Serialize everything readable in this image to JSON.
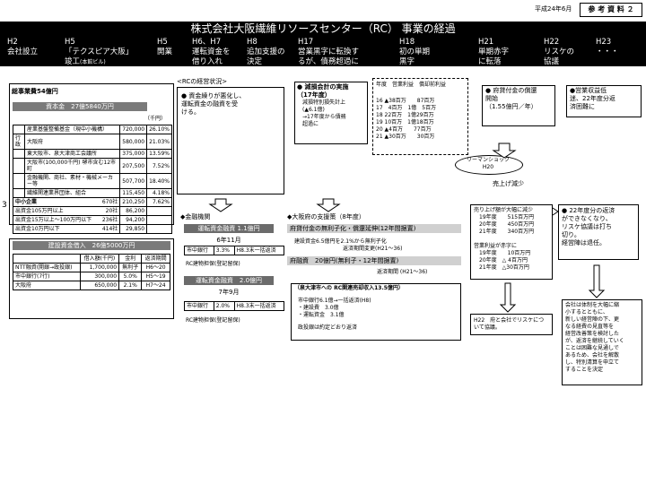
{
  "meta": {
    "date": "平成24年6月",
    "ref": "参 考 資 料 ２"
  },
  "title": "株式会社大阪繊維リソースセンター（RC） 事業の経過",
  "timeline": [
    {
      "era": "H2",
      "text": "会社設立"
    },
    {
      "era": "H5",
      "text": "「テクスピア大阪」",
      "text2": "竣工",
      "sub": "(本館ビル)"
    },
    {
      "era": "H5",
      "text": "開業"
    },
    {
      "era": "H6、H7",
      "text": "運転資金を\n借り入れ"
    },
    {
      "era": "H8",
      "text": "追加支援の\n決定"
    },
    {
      "era": "H17",
      "text": "営業黒字に転換す\nるが、債務超過に"
    },
    {
      "era": "H18",
      "text": "初の単期\n黒字"
    },
    {
      "era": "H21",
      "text": "単期赤字\nに転落"
    },
    {
      "era": "H22",
      "text": "リスケの\n協議"
    },
    {
      "era": "H23",
      "text": "・・・"
    }
  ],
  "page_marker": "3",
  "total": {
    "label": "総事業費54億円",
    "capital_header": "資本金　27億5840万円",
    "unit": "（千円）",
    "rows": [
      [
        "",
        "産業基盤整備基金（現中小機構）",
        "720,000",
        "26.10%"
      ],
      [
        "行政",
        "大阪府",
        "580,000",
        "21.03%"
      ],
      [
        "",
        "東大阪市、泉大津商工会議所",
        "375,000",
        "13.59%"
      ],
      [
        "",
        "大阪市(100,000千円) 堺市含む12市町",
        "207,500",
        "7.52%"
      ],
      [
        "",
        "金融機関、商社、素材・機械メーカー等",
        "507,700",
        "18.40%"
      ],
      [
        "",
        "繊維関連業界団体、組合",
        "115,450",
        "4.18%"
      ]
    ],
    "sme": {
      "label": "中小企業",
      "count": "670社",
      "amount": "210,250",
      "pct": "7.62%"
    },
    "sme_rows": [
      [
        "出資金105万円以上",
        "20社",
        "86,200"
      ],
      [
        "出資金15万以上～100万円以下",
        "236社",
        "94,200"
      ],
      [
        "出資金10万円以下",
        "414社",
        "29,850"
      ]
    ]
  },
  "loans": {
    "header": "建設資金借入　26億5000万円",
    "cols": [
      "借入額(千円)",
      "金利",
      "返済期間"
    ],
    "rows": [
      [
        "NTT融資(開銀→政投銀)",
        "1,700,000",
        "無利子",
        "H6～20"
      ],
      [
        "市中銀行(7行)",
        "300,000",
        "5.0%",
        "H5～19"
      ],
      [
        "大阪府",
        "650,000",
        "2.1%",
        "H7～24"
      ]
    ]
  },
  "rc_status": {
    "title": "<RCの経営状況>",
    "b1": "● 資金繰りが悪化し、\n運転資金の融資を受\nける。",
    "b2_title": "● 減損会計の実施\n（17年度）",
    "b2_text": "減損特別損失計上\n(▲6.1億)\n→17年度から債務\n超過に",
    "table_header": "年度　営業利益　償却前利益",
    "table_rows": [
      "16 ▲38百万　　87百万",
      "17　4百万　1億　5百万",
      "18 22百万　1億29百万",
      "19 10百万　1億18百万",
      "20 ▲4百万　　77百万",
      "21 ▲30百万　　30百万"
    ],
    "b3": "● 府貸付金の償還\n開始\n（1.55億円／年）",
    "b4": "●営業収益低\n迷、22年度分返\n済困難に",
    "lehman": "リーマンショック\nH20",
    "sales_down": "売上げ減少"
  },
  "finance": {
    "title": "◆金融機関",
    "ops1_bar": "運転資金融資 1.1億円",
    "ops1_month": "6年11月",
    "ops1_row": [
      "市中銀行",
      "3.3%",
      "H8.3末一括返済"
    ],
    "ops1_note": "RC建物担保(登記留保)",
    "ops2_bar": "運転資金融資　2.0億円",
    "ops2_month": "7年9月",
    "ops2_row": [
      "市中銀行",
      "2.0%",
      "H8.3末一括返済"
    ],
    "ops2_note": "RC建物担保(登記留保)"
  },
  "osaka": {
    "title": "◆大阪府の支援策（8年度）",
    "bar1": "府貸付金の無利子化・償還延伸(12年間据置)",
    "text1": "建設資金6.5億円を2.1%から無利子化\n　　　　　　　　　返済期間変更(H21～36)",
    "bar2": "府融資　20億円(無利子・12年間据置)",
    "text2": "返済期間 (H21～36)",
    "sub_title": "（泉大津市への RC関連売却収入13.5億円）",
    "sub_text": "市中銀行6.1億→一括返済(H8)\n・建設費　3.0億\n・運転資金　3.1億",
    "sub_note": "政投銀は約定どおり返済"
  },
  "right": {
    "sales": "売り上げ額が大幅に減少\n　19年度　　515百万円\n　20年度　　450百万円\n　21年度　　340百万円\n\n営業利益が赤字に\n　19年度　　10百万円\n　20年度　△ 4百万円\n　21年度　△30百万円",
    "h22": "H22　府と会社でリスケにつ\nいて協議。",
    "b22": "● 22年度分の返済\nができなくなり、\nリスケ協議は打ち\n切り。\n経営陣は退任。",
    "company": "会社は体制を大幅に縮\n小するとともに、\n新しい経営陣の下、更\nなる経費の見直等を\n経営改善策を検討した\nが、返済を継続していく\nことは困難な見通しで\nあるため、会社を解散\nし、特別清算を申立て\nすることを決定"
  }
}
